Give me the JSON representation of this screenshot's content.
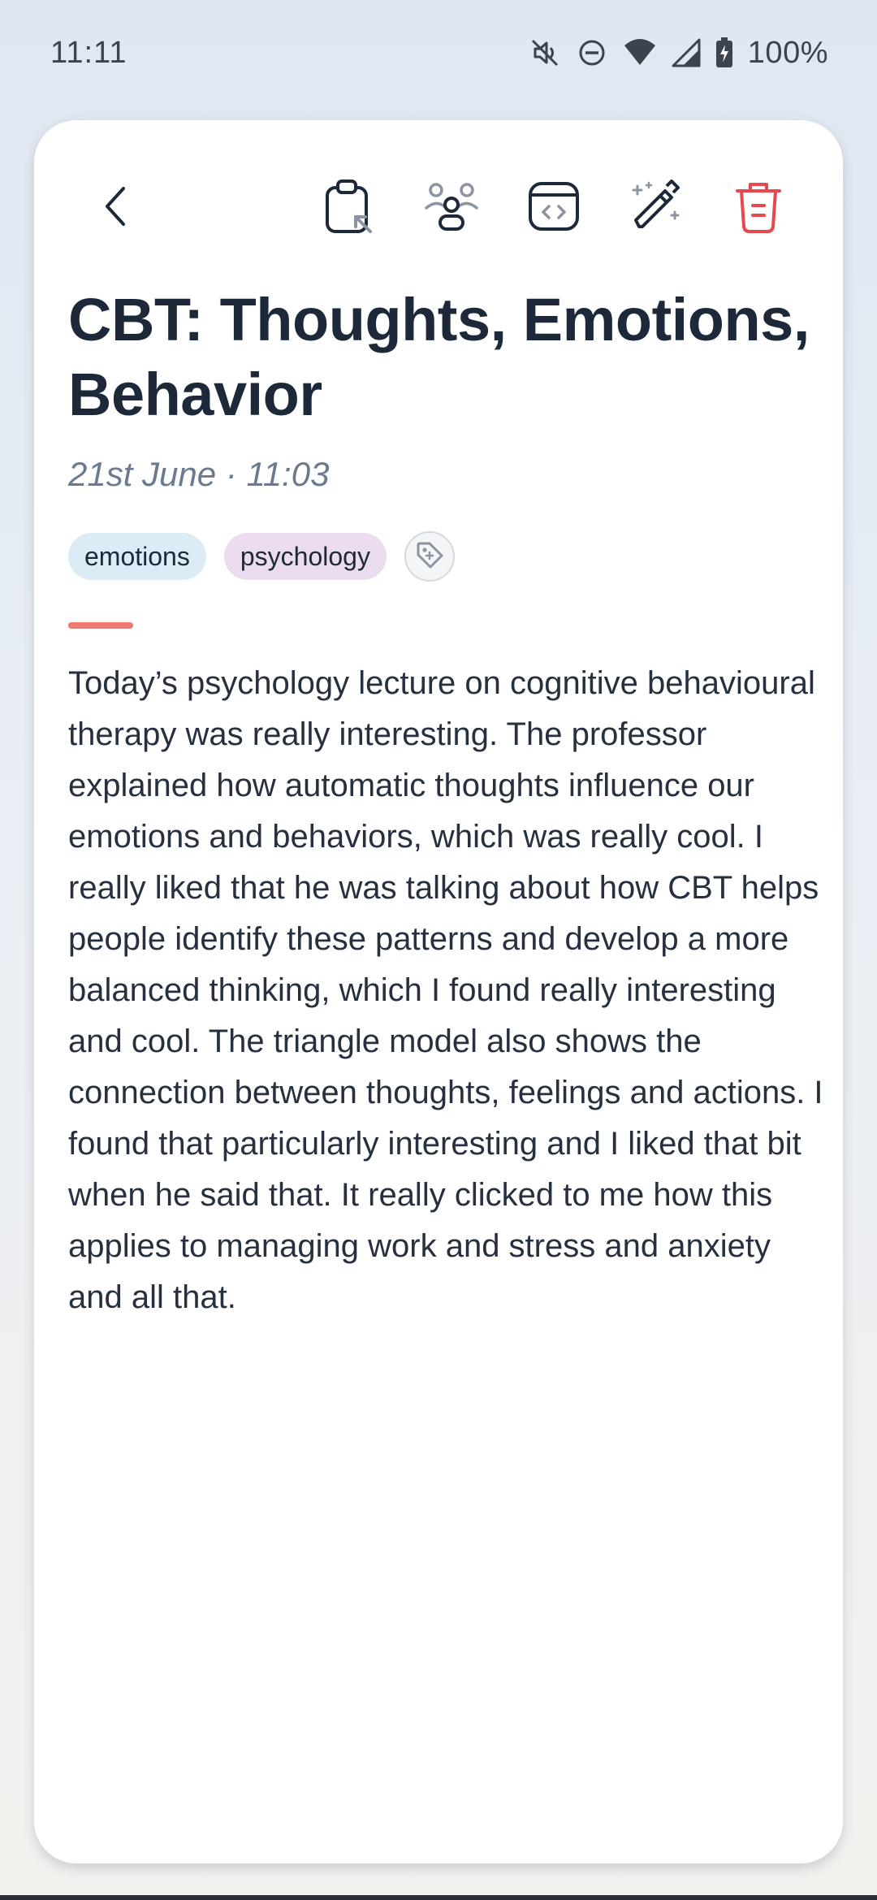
{
  "status_bar": {
    "time": "11:11",
    "battery_text": "100%",
    "icons": [
      "mute-icon",
      "dnd-icon",
      "wifi-icon",
      "signal-icon",
      "battery-charging-icon"
    ]
  },
  "toolbar": {
    "icons": [
      "back-icon",
      "clipboard-icon",
      "people-icon",
      "embed-code-icon",
      "magic-pen-icon",
      "trash-icon"
    ],
    "delete_color": "#e5484d"
  },
  "note": {
    "title": "CBT: Thoughts, Emotions, Behavior",
    "date": "21st June · 11:03",
    "tags": [
      {
        "label": "emotions",
        "color": "#dbecf7"
      },
      {
        "label": "psychology",
        "color": "#ecdcef"
      }
    ],
    "add_tag_icon": "tag-add-icon",
    "accent_color": "#ee7b72",
    "body": "Today’s psychology lecture on cognitive behavioural therapy was really interesting. The professor explained how automatic thoughts influence our emotions and behaviors, which was really cool. I really liked that he was talking about how CBT helps people identify these patterns and develop a more balanced thinking, which I found really interesting and cool. The triangle model also shows the connection between thoughts, feelings and actions. I found that particularly interesting and I liked that bit when he said that. It really clicked to me how this applies to managing work and stress and anxiety and all that."
  }
}
